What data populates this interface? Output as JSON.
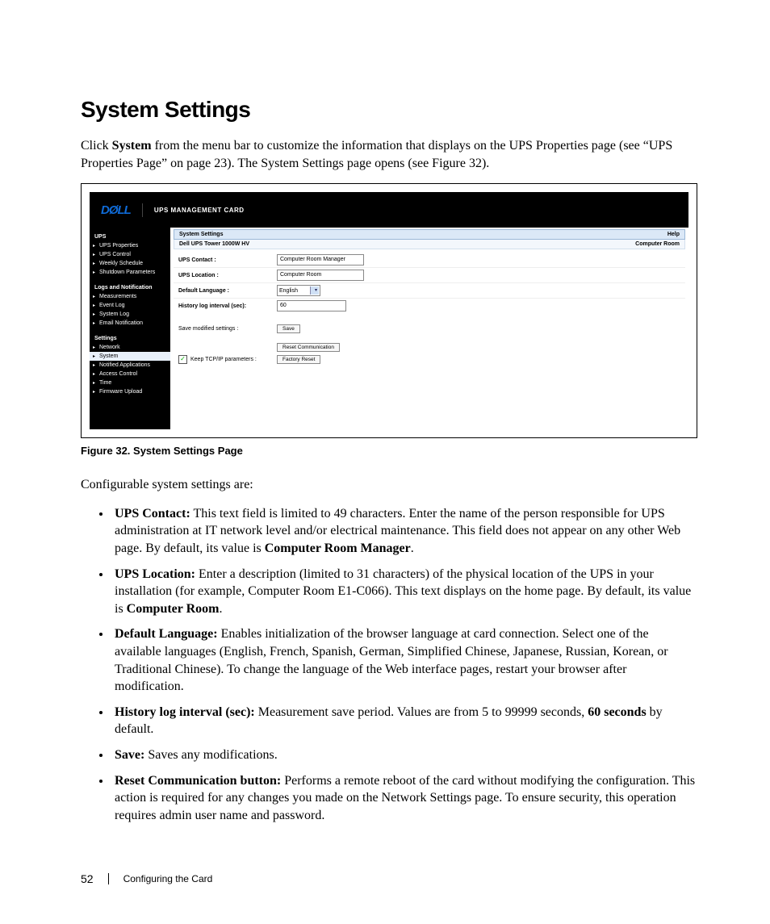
{
  "heading": "System Settings",
  "intro_prefix": "Click ",
  "intro_bold1": "System",
  "intro_rest": " from the menu bar to customize the information that displays on the UPS Properties page (see “UPS Properties Page” on page 23). The System Settings page opens (see Figure 32).",
  "screenshot": {
    "logo": "DØLL",
    "header_title": "UPS MANAGEMENT CARD",
    "nav": {
      "section1": "UPS",
      "items1": [
        "UPS Properties",
        "UPS Control",
        "Weekly Schedule",
        "Shutdown Parameters"
      ],
      "section2": "Logs and Notification",
      "items2": [
        "Measurements",
        "Event Log",
        "System Log",
        "Email Notification"
      ],
      "section3": "Settings",
      "items3": [
        "Network",
        "System",
        "Notified Applications",
        "Access Control",
        "Time",
        "Firmware Upload"
      ]
    },
    "panel": {
      "title": "System Settings",
      "help": "Help",
      "sub_left": "Dell UPS Tower 1000W HV",
      "sub_right": "Computer Room",
      "rows": {
        "contact_label": "UPS Contact :",
        "contact_value": "Computer Room Manager",
        "location_label": "UPS Location :",
        "location_value": "Computer Room",
        "language_label": "Default Language :",
        "language_value": "English",
        "interval_label": "History log interval (sec):",
        "interval_value": "60",
        "save_label": "Save modified settings :",
        "save_btn": "Save",
        "reset_comm_btn": "Reset Communication",
        "keep_tcpip_label": "Keep TCP/IP parameters :",
        "factory_btn": "Factory Reset"
      }
    }
  },
  "figure_caption": "Figure 32. System Settings Page",
  "config_intro": "Configurable system settings are:",
  "bullets": {
    "b1_label": "UPS Contact:",
    "b1_text": " This text field is limited to 49 characters. Enter the name of the person responsible for UPS administration at IT network level and/or electrical maintenance. This field does not appear on any other Web page. By default, its value is ",
    "b1_bold_end": "Computer Room Manager",
    "b1_period": ".",
    "b2_label": "UPS Location:",
    "b2_text": " Enter a description (limited to 31 characters) of the physical location of the UPS in your installation (for example, Computer Room E1-C066). This text displays on the home page. By default, its value is ",
    "b2_bold_end": "Computer Room",
    "b2_period": ".",
    "b3_label": "Default Language:",
    "b3_text": " Enables initialization of the browser language at card connection. Select one of the available languages (English, French, Spanish, German, Simplified Chinese, Japanese, Russian, Korean, or Traditional Chinese). To change the language of the Web interface pages, restart your browser after modification.",
    "b4_label": "History log interval (sec):",
    "b4_text": " Measurement save period. Values are from 5 to 99999 seconds, ",
    "b4_bold_end": "60 seconds",
    "b4_rest": " by default.",
    "b5_label": "Save:",
    "b5_text": " Saves any modifications.",
    "b6_label": "Reset Communication button:",
    "b6_text": " Performs a remote reboot of the card without modifying the configuration. This action is required for any changes you made on the Network Settings page. To ensure security, this operation requires admin user name and password."
  },
  "footer": {
    "page_number": "52",
    "section": "Configuring the Card"
  }
}
